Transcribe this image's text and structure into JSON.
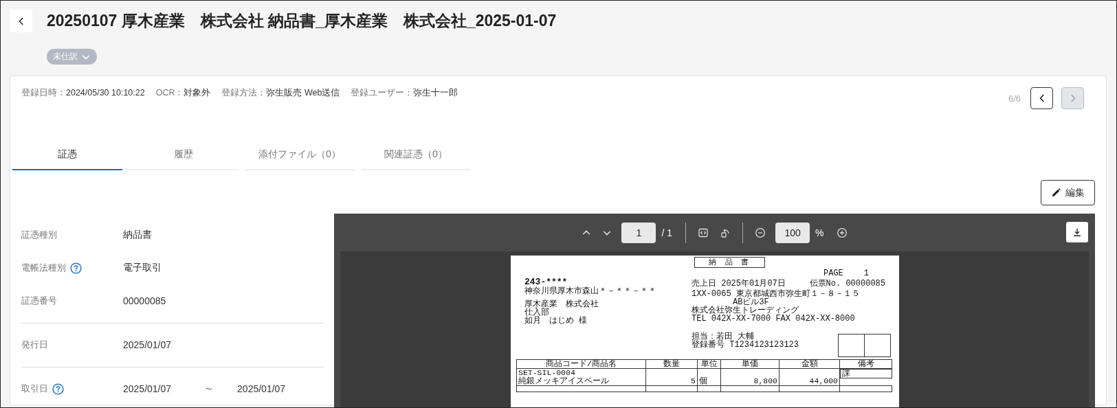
{
  "header": {
    "title": "20250107 厚木産業　株式会社 納品書_厚木産業　株式会社_2025-01-07",
    "status_badge": "未仕訳"
  },
  "meta": [
    {
      "label": "登録日時：",
      "value": "2024/05/30 10:10:22"
    },
    {
      "label": "OCR：",
      "value": "対象外"
    },
    {
      "label": "登録方法：",
      "value": "弥生販売 Web送信"
    },
    {
      "label": "登録ユーザー：",
      "value": "弥生十一郎"
    }
  ],
  "pager": {
    "position": "6/6",
    "buttons": [
      {
        "kind": "prev",
        "disabled": false
      },
      {
        "kind": "next",
        "disabled": true
      }
    ]
  },
  "tabs": [
    {
      "label": "証憑",
      "selected": true
    },
    {
      "label": "履歴",
      "selected": false
    },
    {
      "label": "添付ファイル（0）",
      "selected": false
    },
    {
      "label": "関連証憑（0）",
      "selected": false
    }
  ],
  "edit_button": {
    "label": "編集"
  },
  "field_sections": [
    {
      "fields": [
        {
          "label": "証憑種別",
          "value": "納品書",
          "help": false
        },
        {
          "label": "電帳法種別",
          "value": "電子取引",
          "help": true
        },
        {
          "label": "証憑番号",
          "value": "00000085",
          "help": false
        }
      ]
    },
    {
      "fields": [
        {
          "label": "発行日",
          "value": "2025/01/07",
          "help": false
        }
      ]
    },
    {
      "fields": [
        {
          "label": "取引日",
          "value": "2025/01/07",
          "range_separator": "～",
          "value_end": "2025/01/07",
          "help": true
        }
      ]
    }
  ],
  "viewer": {
    "page": "1",
    "page_total": "/ 1",
    "zoom": "100",
    "zoom_unit": "%"
  },
  "document": {
    "title": "納 品 書",
    "page_label": "PAGE",
    "page_number": "1",
    "recipient_postal": "243-****",
    "recipient_address": "神奈川県厚木市森山＊－＊＊－＊＊",
    "recipient_company": "厚木産業　株式会社",
    "recipient_department": "仕入部",
    "recipient_person": "如月　はじめ 様",
    "sales_date": "売上日 2025年01月07日",
    "slip_no": "伝票No. 00000085",
    "sender_address": "1XX-0065 東京都城西市弥生町１－８－１５",
    "sender_building": "ABビル3F",
    "sender_company": "株式会社弥生トレーディング",
    "sender_phone": "TEL 042X-XX-7000 FAX 042X-XX-8000",
    "staff": "担当：若田 大輔",
    "registration": "登録番号 T1234123123123",
    "table": {
      "columns": [
        "商品コード/商品名",
        "数量",
        "単位",
        "単価",
        "金額",
        "備考"
      ],
      "rows": [
        {
          "code": "SET-SIL-0004",
          "name": "純銀メッキアイスペール",
          "quantity": "5",
          "unit": "個",
          "unit_price": "8,800",
          "amount": "44,000",
          "note": "課"
        }
      ]
    }
  }
}
